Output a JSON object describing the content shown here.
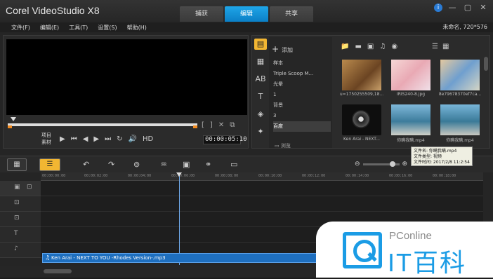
{
  "app": {
    "title": "Corel VideoStudio X8"
  },
  "steps": [
    {
      "label": "捕获",
      "active": false
    },
    {
      "label": "编辑",
      "active": true
    },
    {
      "label": "共享",
      "active": false
    }
  ],
  "window_controls": {
    "info": "i",
    "minimize": "—",
    "restore": "▢",
    "close": "✕"
  },
  "menu": {
    "items": [
      "文件(F)",
      "编辑(E)",
      "工具(T)",
      "设置(S)",
      "帮助(H)"
    ],
    "project_info": "未命名, 720*576"
  },
  "preview": {
    "mode_project": "项目",
    "mode_clip": "素材",
    "timecode": "00:00:05:10",
    "hd": "HD",
    "trim_in": "[",
    "trim_out": "]"
  },
  "library": {
    "add_label": "添加",
    "browse_label": "浏览",
    "folders": [
      {
        "label": "样本",
        "active": false
      },
      {
        "label": "Triple Scoop M...",
        "active": false
      },
      {
        "label": "光晕",
        "active": false
      },
      {
        "label": "1",
        "active": false
      },
      {
        "label": "背景",
        "active": false
      },
      {
        "label": "3",
        "active": false
      },
      {
        "label": "百度",
        "active": true
      }
    ],
    "thumbnails": [
      {
        "caption": "u=1750255509,18..."
      },
      {
        "caption": "IRIS240-8.jpg"
      },
      {
        "caption": "8e79678370ef7ca..."
      },
      {
        "caption": "Ken Arai - NEXT..."
      },
      {
        "caption": "你瞒我瞒.mp4"
      },
      {
        "caption": "你瞒我瞒.mp4"
      }
    ]
  },
  "tooltip": {
    "line1": "文件名: 你瞒我瞒.mp4",
    "line2": "文件类型: 视频",
    "line3": "文件时间: 2017/2/8 11:2:54"
  },
  "timeline": {
    "zoom_out": "⊖",
    "zoom_in": "⊕",
    "ruler": [
      "00:00:00:00",
      "00:00:02:00",
      "00:00:04:00",
      "00:00:06:00",
      "00:00:08:00",
      "00:00:10:00",
      "00:00:12:00",
      "00:00:14:00",
      "00:00:16:00",
      "00:00:18:00"
    ],
    "music_clip": "Ken Arai - NEXT TO YOU -Rhodes Version-.mp3"
  },
  "watermark": {
    "brand": "PConline",
    "title": "IT百科"
  }
}
